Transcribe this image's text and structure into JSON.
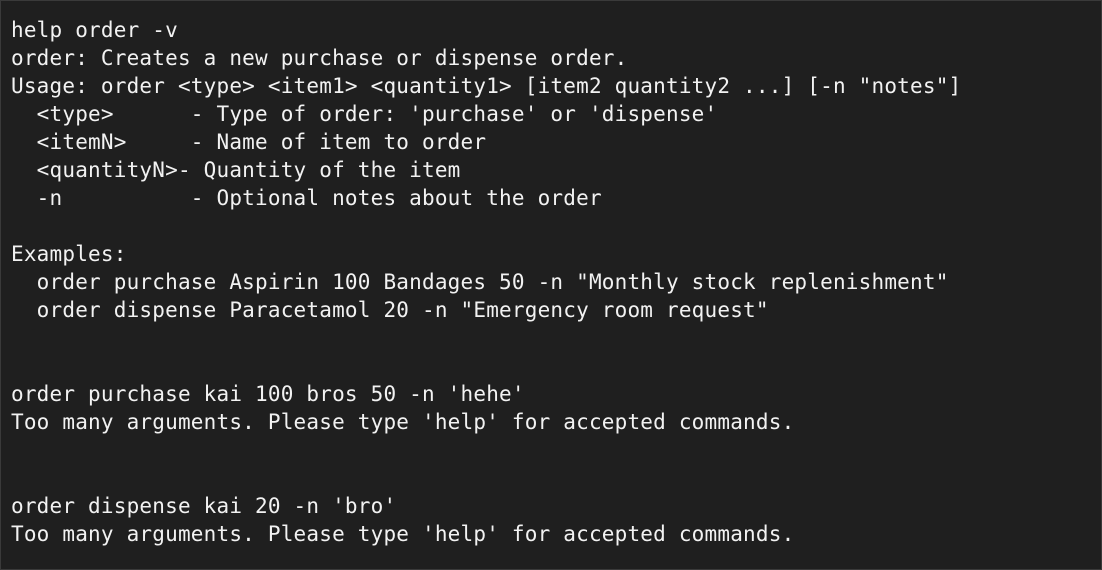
{
  "terminal": {
    "lines": [
      "help order -v",
      "order: Creates a new purchase or dispense order.",
      "Usage: order <type> <item1> <quantity1> [item2 quantity2 ...] [-n \"notes\"]",
      "  <type>      - Type of order: 'purchase' or 'dispense'",
      "  <itemN>     - Name of item to order",
      "  <quantityN>- Quantity of the item",
      "  -n          - Optional notes about the order",
      "",
      "Examples:",
      "  order purchase Aspirin 100 Bandages 50 -n \"Monthly stock replenishment\"",
      "  order dispense Paracetamol 20 -n \"Emergency room request\"",
      "",
      "",
      "order purchase kai 100 bros 50 -n 'hehe'",
      "Too many arguments. Please type 'help' for accepted commands.",
      "",
      "",
      "order dispense kai 20 -n 'bro'",
      "Too many arguments. Please type 'help' for accepted commands."
    ]
  }
}
